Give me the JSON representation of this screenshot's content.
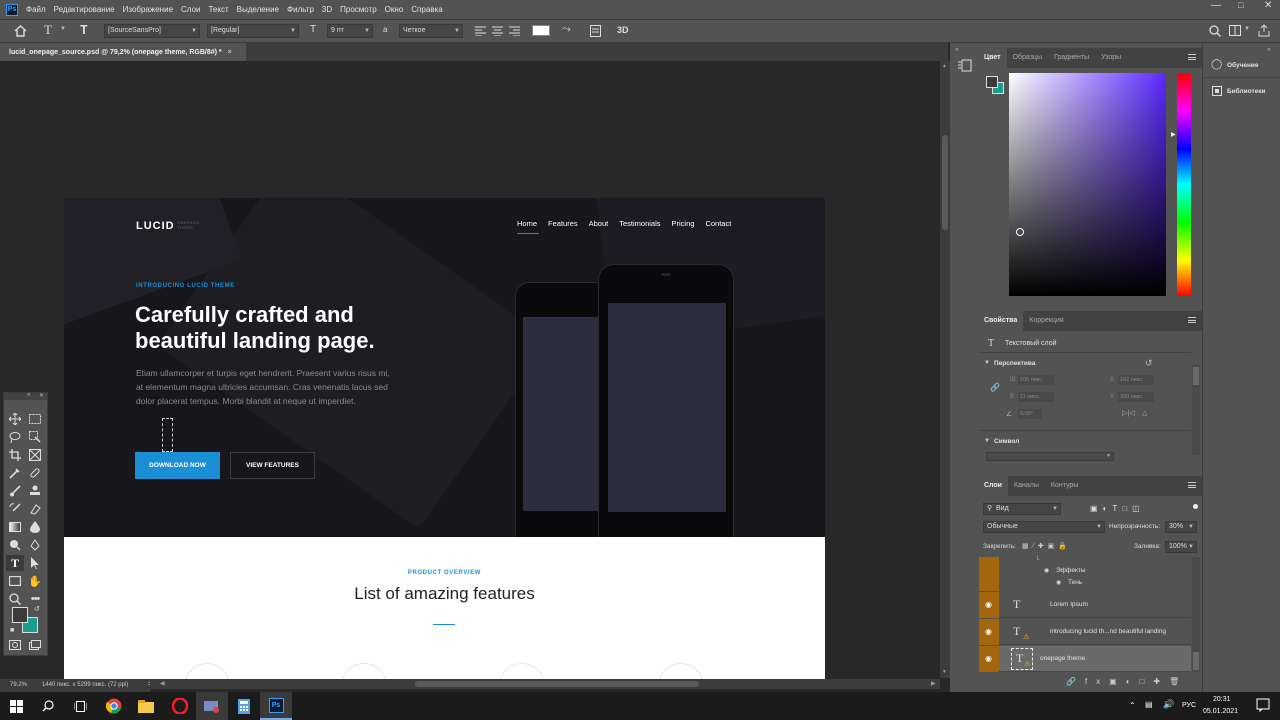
{
  "menubar": {
    "app_icon": "Ps",
    "items": [
      "Файл",
      "Редактирование",
      "Изображение",
      "Слои",
      "Текст",
      "Выделение",
      "Фильтр",
      "3D",
      "Просмотр",
      "Окно",
      "Справка"
    ]
  },
  "options_bar": {
    "font_family": "[SourceSansPro]",
    "font_style": "[Regular]",
    "font_size": "9 пт",
    "antialias": "Четкое",
    "threed": "3D"
  },
  "document_tab": {
    "title": "lucid_onepage_source.psd @ 79,2% (onepage theme, RGB/8#) *",
    "close": "×"
  },
  "artboard": {
    "logo": "LUCID",
    "logo_sub": "ONEPAGE THEME",
    "nav": [
      "Home",
      "Features",
      "About",
      "Testimonials",
      "Pricing",
      "Contact"
    ],
    "intro": "INTRODUCING LUCID THEME",
    "headline_line1": "Carefully crafted and",
    "headline_line2": "beautiful landing page.",
    "body_text": "Etiam ullamcorper et turpis eget hendrerit. Praesent varius risus mi, at elementum magna ultricies accumsan. Cras venenatis lacus sed dolor placerat tempus. Morbi blandit at neque ut imperdiet.",
    "download_button": "DOWNLOAD NOW",
    "features_button": "VIEW FEATURES",
    "product_overview": "PRODUCT OVERVIEW",
    "features_title": "List of amazing features"
  },
  "status": {
    "zoom": "79,2%",
    "doc_size": "1440 пикс. x 5299 пикс. (72 ppi)",
    "arrow": ">"
  },
  "color_panel": {
    "tabs": [
      "Цвет",
      "Образцы",
      "Градиенты",
      "Узоры"
    ],
    "foreground": "#3b3b3b",
    "background": "#1a9c8f"
  },
  "properties_panel": {
    "tabs": [
      "Свойства",
      "Коррекция"
    ],
    "layer_type": "Текстовый слой",
    "transform_title": "Перспектива",
    "w_label": "Ш",
    "w_value": "105 пикс.",
    "x_label": "X",
    "x_value": "162 пикс.",
    "h_label": "В",
    "h_value": "11 пикс.",
    "y_label": "Y",
    "y_value": "300 пикс.",
    "angle_value": "0,00°",
    "character_title": "Символ"
  },
  "layers_panel": {
    "tabs": [
      "Слои",
      "Каналы",
      "Контуры"
    ],
    "filter_kind": "Вид",
    "blend_mode": "Обычные",
    "opacity_label": "Непрозрачность:",
    "opacity": "30%",
    "lock_label": "Закрепить:",
    "fill_label": "Заливка:",
    "fill": "100%",
    "effects_label": "Эффекты",
    "shadow_label": "Тень",
    "layers": [
      {
        "name": "Lorem Ipsum"
      },
      {
        "name": "introducing lucid th...nd beautiful landing"
      },
      {
        "name": "onepage theme"
      }
    ]
  },
  "dock": {
    "learn": "Обучение",
    "libraries": "Библиотеки"
  },
  "taskbar": {
    "lang": "РУС",
    "time": "20:31",
    "date": "05.01.2021"
  },
  "colors": {
    "accent_blue": "#1a8fd6",
    "layer_eye": "#a3660d",
    "panel": "#535353"
  }
}
